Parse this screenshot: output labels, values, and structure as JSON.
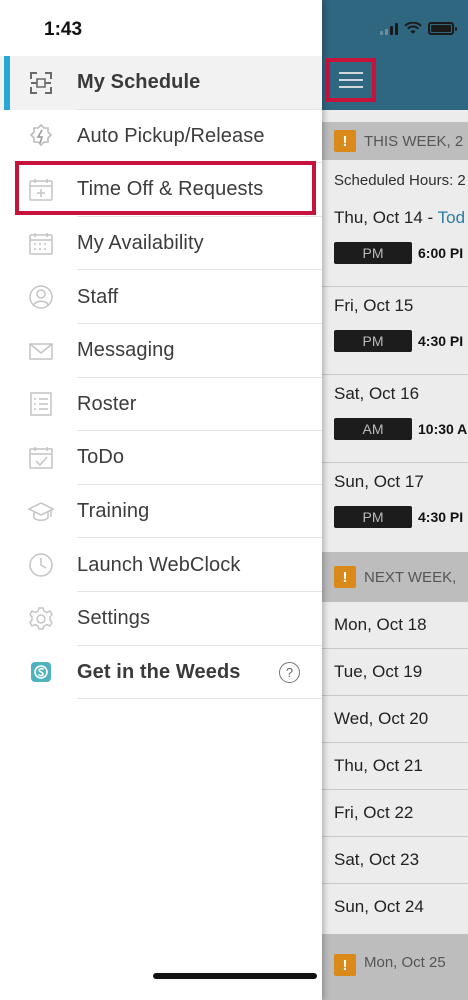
{
  "status_bar": {
    "time": "1:43"
  },
  "drawer": {
    "items": [
      {
        "label": "My Schedule",
        "icon": "schedule-grid-icon",
        "active": true
      },
      {
        "label": "Auto Pickup/Release",
        "icon": "auto-pickup-icon"
      },
      {
        "label": "Time Off & Requests",
        "icon": "calendar-request-icon",
        "highlighted": true
      },
      {
        "label": "My Availability",
        "icon": "calendar-icon"
      },
      {
        "label": "Staff",
        "icon": "person-icon"
      },
      {
        "label": "Messaging",
        "icon": "envelope-icon"
      },
      {
        "label": "Roster",
        "icon": "list-icon"
      },
      {
        "label": "ToDo",
        "icon": "checklist-icon"
      },
      {
        "label": "Training",
        "icon": "graduation-cap-icon"
      },
      {
        "label": "Launch WebClock",
        "icon": "clock-icon"
      },
      {
        "label": "Settings",
        "icon": "gear-icon"
      },
      {
        "label": "Get in the Weeds",
        "icon": "weeds-logo-icon",
        "help": "?"
      }
    ]
  },
  "schedule": {
    "this_week": "THIS WEEK, 2",
    "scheduled_hours": "Scheduled Hours: 2",
    "days": [
      {
        "day": "Thu, Oct 14 - ",
        "today": "Tod",
        "shift_label": "PM",
        "shift_time": "6:00 PI"
      },
      {
        "day": "Fri, Oct 15",
        "shift_label": "PM",
        "shift_time": "4:30 PI"
      },
      {
        "day": "Sat, Oct 16",
        "shift_label": "AM",
        "shift_time": "10:30 A"
      },
      {
        "day": "Sun, Oct 17",
        "shift_label": "PM",
        "shift_time": "4:30 PI"
      }
    ],
    "next_week": "NEXT WEEK,",
    "next_days": [
      "Mon, Oct 18",
      "Tue, Oct 19",
      "Wed, Oct 20",
      "Thu, Oct 21",
      "Fri, Oct 22",
      "Sat, Oct 23",
      "Sun, Oct 24"
    ],
    "following": "Mon, Oct 25"
  },
  "colors": {
    "accent": "#27a8d8",
    "highlight": "#c7123b",
    "header": "#2f6680",
    "warning": "#d98a1b"
  }
}
